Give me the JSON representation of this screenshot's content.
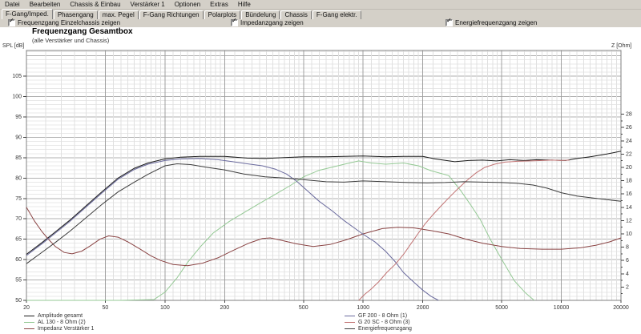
{
  "menu": {
    "items": [
      "Datei",
      "Bearbeiten",
      "Chassis & Einbau",
      "Verstärker 1",
      "Optionen",
      "Extras",
      "Hilfe"
    ]
  },
  "tabs": {
    "active": "F-Gang/Imped.",
    "items": [
      "F-Gang/Imped.",
      "Phasengang",
      "max. Pegel",
      "F-Gang Richtungen",
      "Polarplots",
      "Bündelung",
      "Chassis",
      "F-Gang elektr."
    ]
  },
  "checkboxes": [
    {
      "label": "Frequenzgang Einzelchassis zeigen",
      "checked": true,
      "check_glyph": "✓"
    },
    {
      "label": "Impedanzgang zeigen",
      "checked": true,
      "check_glyph": "✓"
    },
    {
      "label": "Energiefrequenzgang zeigen",
      "checked": true,
      "check_glyph": "✓"
    }
  ],
  "chart": {
    "title": "Frequenzgang Gesamtbox",
    "subtitle": "(alle Verstärker und Chassis)",
    "left_axis_label": "SPL [dB]",
    "right_axis_label": "Z [Ohm]"
  },
  "colors": {
    "window_face": "#d4d0c8",
    "plot_background": "#ffffff",
    "grid_minor": "#e8e8e8",
    "grid_major": "#b2b2b2",
    "axis_border": "#808080"
  },
  "chart_data": {
    "type": "line",
    "title": "Frequenzgang Gesamtbox",
    "subtitle": "(alle Verstärker und Chassis)",
    "grid": "on",
    "legend_position": "bottom",
    "x_axis": {
      "scale": "log",
      "min": 20,
      "max": 20000,
      "ticks": [
        20,
        50,
        100,
        200,
        500,
        1000,
        2000,
        5000,
        10000,
        20000
      ]
    },
    "y_left": {
      "label": "SPL [dB]",
      "unit": "dB",
      "min": 50,
      "max": 105,
      "tick_step": 5,
      "ticks": [
        105,
        100,
        95,
        90,
        85,
        80,
        75,
        70,
        65,
        60,
        55,
        50
      ]
    },
    "y_right": {
      "label": "Z [Ohm]",
      "unit": "Ohm",
      "min": 0,
      "max": 28,
      "tick_step": 2,
      "ticks": [
        28,
        26,
        24,
        22,
        20,
        18,
        16,
        14,
        12,
        10,
        8,
        6,
        4,
        2
      ]
    },
    "series": [
      {
        "name": "Amplitude gesamt",
        "color": "#1a1a1a",
        "axis": "left",
        "points": [
          [
            20,
            61.3
          ],
          [
            24,
            64.2
          ],
          [
            28,
            66.8
          ],
          [
            33,
            69.6
          ],
          [
            40,
            73.2
          ],
          [
            48,
            76.6
          ],
          [
            58,
            80.0
          ],
          [
            70,
            82.4
          ],
          [
            82,
            83.7
          ],
          [
            100,
            84.7
          ],
          [
            120,
            85.1
          ],
          [
            150,
            85.3
          ],
          [
            200,
            85.3
          ],
          [
            260,
            84.9
          ],
          [
            320,
            84.8
          ],
          [
            400,
            85.0
          ],
          [
            500,
            85.2
          ],
          [
            650,
            85.2
          ],
          [
            800,
            85.3
          ],
          [
            1000,
            85.4
          ],
          [
            1300,
            85.2
          ],
          [
            1600,
            85.3
          ],
          [
            2000,
            85.3
          ],
          [
            2300,
            84.7
          ],
          [
            2900,
            84.0
          ],
          [
            3400,
            84.3
          ],
          [
            4000,
            84.4
          ],
          [
            4700,
            84.2
          ],
          [
            5500,
            84.5
          ],
          [
            6500,
            84.3
          ],
          [
            7500,
            84.5
          ],
          [
            9000,
            84.4
          ],
          [
            10500,
            84.3
          ],
          [
            12000,
            84.8
          ],
          [
            14000,
            85.2
          ],
          [
            17000,
            85.9
          ],
          [
            20000,
            86.6
          ]
        ]
      },
      {
        "name": "AL 130 - 8 Ohm (2)",
        "color": "#94c994",
        "axis": "left",
        "points": [
          [
            20,
            50.0
          ],
          [
            60,
            50.0
          ],
          [
            88,
            50.2
          ],
          [
            100,
            52.0
          ],
          [
            115,
            55.5
          ],
          [
            130,
            59.3
          ],
          [
            150,
            63.0
          ],
          [
            175,
            66.5
          ],
          [
            210,
            69.3
          ],
          [
            250,
            71.5
          ],
          [
            300,
            73.8
          ],
          [
            360,
            76.0
          ],
          [
            430,
            78.2
          ],
          [
            500,
            80.3
          ],
          [
            600,
            81.9
          ],
          [
            700,
            82.7
          ],
          [
            820,
            83.5
          ],
          [
            950,
            84.2
          ],
          [
            1100,
            83.7
          ],
          [
            1300,
            83.4
          ],
          [
            1600,
            83.7
          ],
          [
            1900,
            83.0
          ],
          [
            2200,
            81.8
          ],
          [
            2700,
            80.6
          ],
          [
            3100,
            77.0
          ],
          [
            3500,
            73.3
          ],
          [
            3900,
            69.8
          ],
          [
            4400,
            64.8
          ],
          [
            5100,
            59.4
          ],
          [
            5800,
            54.8
          ],
          [
            6600,
            51.8
          ],
          [
            7300,
            50.0
          ]
        ]
      },
      {
        "name": "Impedanz Verstärker 1",
        "color": "#8b4545",
        "axis": "right",
        "points": [
          [
            20,
            14.0
          ],
          [
            22,
            11.9
          ],
          [
            24,
            10.3
          ],
          [
            26,
            9.1
          ],
          [
            28,
            8.1
          ],
          [
            31,
            7.2
          ],
          [
            34,
            7.0
          ],
          [
            38,
            7.4
          ],
          [
            42,
            8.2
          ],
          [
            47,
            9.2
          ],
          [
            52,
            9.7
          ],
          [
            58,
            9.5
          ],
          [
            65,
            8.8
          ],
          [
            75,
            7.7
          ],
          [
            85,
            6.7
          ],
          [
            95,
            6.0
          ],
          [
            110,
            5.4
          ],
          [
            130,
            5.2
          ],
          [
            155,
            5.6
          ],
          [
            185,
            6.4
          ],
          [
            220,
            7.5
          ],
          [
            265,
            8.6
          ],
          [
            310,
            9.3
          ],
          [
            340,
            9.4
          ],
          [
            390,
            9.0
          ],
          [
            460,
            8.5
          ],
          [
            560,
            8.1
          ],
          [
            680,
            8.4
          ],
          [
            820,
            9.1
          ],
          [
            1000,
            10.0
          ],
          [
            1250,
            10.8
          ],
          [
            1500,
            11.0
          ],
          [
            1800,
            10.9
          ],
          [
            2200,
            10.5
          ],
          [
            2700,
            10.0
          ],
          [
            3300,
            9.2
          ],
          [
            4000,
            8.6
          ],
          [
            5000,
            8.1
          ],
          [
            6200,
            7.8
          ],
          [
            8000,
            7.7
          ],
          [
            10000,
            7.7
          ],
          [
            12500,
            7.9
          ],
          [
            15000,
            8.3
          ],
          [
            17500,
            8.8
          ],
          [
            20000,
            9.4
          ]
        ]
      },
      {
        "name": "GF 200 - 8 Ohm (1)",
        "color": "#6a6a9d",
        "axis": "left",
        "points": [
          [
            20,
            61.0
          ],
          [
            24,
            63.9
          ],
          [
            28,
            66.5
          ],
          [
            33,
            69.3
          ],
          [
            40,
            72.9
          ],
          [
            48,
            76.3
          ],
          [
            58,
            79.7
          ],
          [
            70,
            82.1
          ],
          [
            82,
            83.4
          ],
          [
            100,
            84.3
          ],
          [
            120,
            84.7
          ],
          [
            150,
            84.8
          ],
          [
            185,
            84.5
          ],
          [
            220,
            84.0
          ],
          [
            260,
            83.5
          ],
          [
            310,
            83.0
          ],
          [
            360,
            82.2
          ],
          [
            410,
            81.0
          ],
          [
            460,
            79.3
          ],
          [
            520,
            77.0
          ],
          [
            600,
            74.3
          ],
          [
            700,
            71.9
          ],
          [
            800,
            69.6
          ],
          [
            900,
            67.8
          ],
          [
            1000,
            66.2
          ],
          [
            1150,
            64.3
          ],
          [
            1300,
            62.0
          ],
          [
            1450,
            59.5
          ],
          [
            1600,
            56.8
          ],
          [
            1800,
            54.5
          ],
          [
            2000,
            52.5
          ],
          [
            2200,
            51.0
          ],
          [
            2400,
            50.0
          ]
        ]
      },
      {
        "name": "G 20 SC - 8 Ohm (3)",
        "color": "#c27474",
        "axis": "left",
        "points": [
          [
            950,
            50.0
          ],
          [
            1020,
            51.5
          ],
          [
            1100,
            52.8
          ],
          [
            1200,
            54.6
          ],
          [
            1320,
            56.9
          ],
          [
            1450,
            58.8
          ],
          [
            1600,
            61.3
          ],
          [
            1750,
            64.0
          ],
          [
            1900,
            66.5
          ],
          [
            2050,
            68.7
          ],
          [
            2250,
            71.0
          ],
          [
            2500,
            73.4
          ],
          [
            2750,
            75.5
          ],
          [
            3000,
            77.3
          ],
          [
            3300,
            79.2
          ],
          [
            3700,
            81.2
          ],
          [
            4100,
            82.6
          ],
          [
            4600,
            83.4
          ],
          [
            5200,
            83.9
          ],
          [
            6000,
            84.1
          ],
          [
            7000,
            84.2
          ],
          [
            8000,
            84.3
          ],
          [
            9000,
            84.4
          ],
          [
            10000,
            84.3
          ],
          [
            11000,
            84.4
          ]
        ]
      },
      {
        "name": "Energiefrequenzgang",
        "color": "#3c3c3c",
        "axis": "left",
        "points": [
          [
            20,
            59.0
          ],
          [
            24,
            61.8
          ],
          [
            28,
            64.2
          ],
          [
            33,
            66.9
          ],
          [
            40,
            70.3
          ],
          [
            48,
            73.5
          ],
          [
            58,
            76.6
          ],
          [
            70,
            79.0
          ],
          [
            82,
            80.9
          ],
          [
            100,
            83.0
          ],
          [
            115,
            83.5
          ],
          [
            135,
            83.3
          ],
          [
            160,
            82.7
          ],
          [
            200,
            82.0
          ],
          [
            250,
            81.0
          ],
          [
            320,
            80.3
          ],
          [
            400,
            80.0
          ],
          [
            500,
            79.6
          ],
          [
            650,
            79.1
          ],
          [
            800,
            79.0
          ],
          [
            1000,
            79.3
          ],
          [
            1300,
            79.1
          ],
          [
            1700,
            78.9
          ],
          [
            2100,
            78.8
          ],
          [
            2600,
            78.9
          ],
          [
            3200,
            79.1
          ],
          [
            4000,
            79.0
          ],
          [
            5000,
            78.9
          ],
          [
            6000,
            78.7
          ],
          [
            7200,
            78.3
          ],
          [
            8500,
            77.5
          ],
          [
            10000,
            76.4
          ],
          [
            12000,
            75.6
          ],
          [
            14500,
            75.1
          ],
          [
            17000,
            74.7
          ],
          [
            20000,
            74.3
          ]
        ]
      }
    ],
    "legend": {
      "columns": [
        [
          0,
          1,
          2
        ],
        [
          3,
          4,
          5
        ]
      ]
    }
  }
}
